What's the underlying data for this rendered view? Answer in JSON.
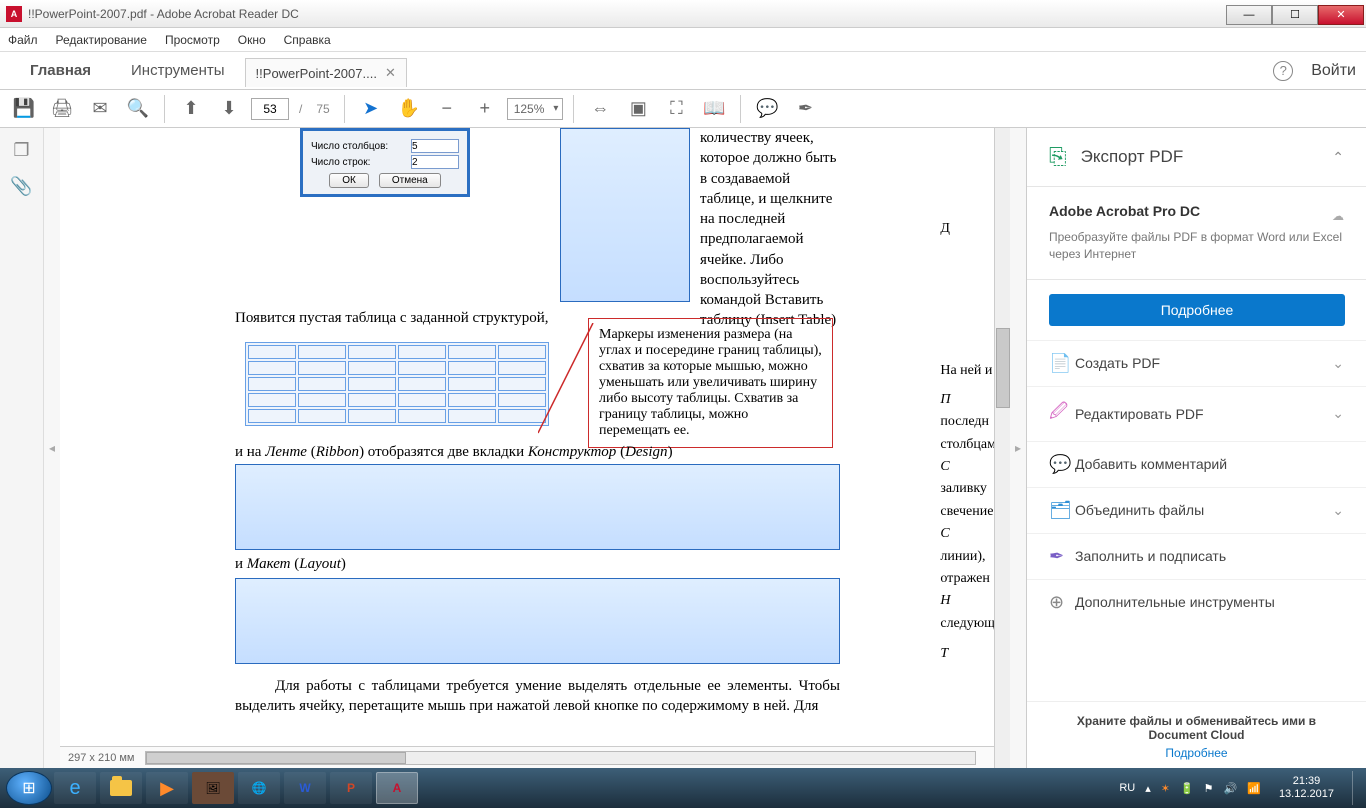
{
  "titlebar": {
    "title": "!!PowerPoint-2007.pdf - Adobe Acrobat Reader DC"
  },
  "menu": {
    "file": "Файл",
    "edit": "Редактирование",
    "view": "Просмотр",
    "window": "Окно",
    "help": "Справка"
  },
  "tabs": {
    "home": "Главная",
    "tools": "Инструменты",
    "doc": "!!PowerPoint-2007....",
    "login": "Войти"
  },
  "toolbar": {
    "page_current": "53",
    "page_sep": "/",
    "page_total": "75",
    "zoom": "125%"
  },
  "status": {
    "dims": "297 x 210 мм"
  },
  "rpanel": {
    "export_title": "Экспорт PDF",
    "pro_title": "Adobe Acrobat Pro DC",
    "pro_desc": "Преобразуйте файлы PDF в формат Word или Excel через Интернет",
    "more_btn": "Подробнее",
    "create": "Создать PDF",
    "editpdf": "Редактировать PDF",
    "comment": "Добавить комментарий",
    "combine": "Объединить файлы",
    "fillsign": "Заполнить и подписать",
    "moretools": "Дополнительные инструменты",
    "cloud1": "Храните файлы и обменивайтесь ими в",
    "cloud2": "Document Cloud",
    "learn": "Подробнее"
  },
  "page_content": {
    "cols_label": "Число столбцов:",
    "rows_label": "Число строк:",
    "cols_val": "5",
    "rows_val": "2",
    "ok": "ОК",
    "cancel": "Отмена",
    "txt1": "Появится пустая таблица с заданной структурой,",
    "txt2_a": "и на ",
    "txt2_b": "Ленте",
    "txt2_c": " (",
    "txt2_d": "Ribbon",
    "txt2_e": ") отобразятся две вкладки ",
    "txt2_f": "Конструктор",
    "txt2_g": " (",
    "txt2_h": "Design",
    "txt2_i": ")",
    "txt3_a": "и ",
    "txt3_b": "Макет",
    "txt3_c": " (",
    "txt3_d": "Layout",
    "txt3_e": ")",
    "callout": "Маркеры изменения размера (на углах и посередине границ таблицы), схватив за которые мышью, можно уменьшать или увеличивать ширину либо высоту таблицы. Схватив за границу таблицы, можно перемещать ее.",
    "side_text": "количеству ячеек, которое должно быть в создаваемой таблице, и щелкните на последней предполагаемой ячейке. Либо воспользуйтесь командой Вставить таблицу (Insert Table)",
    "para4": "Для работы с таблицами требуется умение выделять отдельные ее элементы. Чтобы выделить ячейку, перетащите мышь при нажатой левой кнопке по содержимому в ней. Для",
    "sidecut_lines": [
      "Д",
      "На ней и",
      "П",
      "последн",
      "столбцам",
      "С",
      "заливку",
      "свечение",
      "С",
      "линии),",
      "отражен",
      "Н",
      "следующ",
      "Т"
    ]
  },
  "tray": {
    "lang": "RU",
    "time": "21:39",
    "date": "13.12.2017"
  }
}
